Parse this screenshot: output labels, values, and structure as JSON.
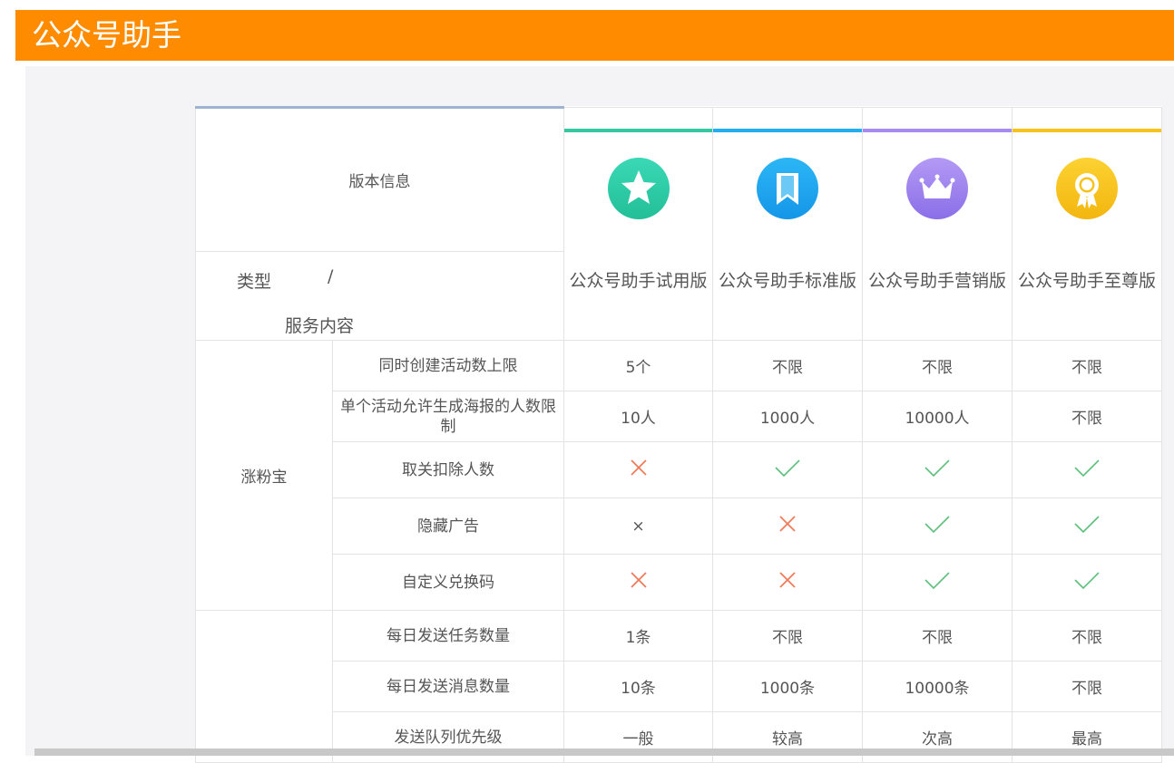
{
  "app": {
    "title": "公众号助手"
  },
  "header": {
    "info_label": "版本信息",
    "type_label": "类型",
    "slash": "/",
    "service_label": "服务内容"
  },
  "versions": [
    {
      "name": "公众号助手试用版",
      "accent": "#36c8a0",
      "icon": "star-icon"
    },
    {
      "name": "公众号助手标准版",
      "accent": "#22aef0",
      "icon": "bookmark-icon"
    },
    {
      "name": "公众号助手营销版",
      "accent": "#a48cf0",
      "icon": "crown-icon"
    },
    {
      "name": "公众号助手至尊版",
      "accent": "#f7c21b",
      "icon": "medal-icon"
    }
  ],
  "groups": [
    {
      "name": "涨粉宝",
      "rows": [
        {
          "feature": "同时创建活动数上限",
          "values": [
            "5个",
            "不限",
            "不限",
            "不限"
          ]
        },
        {
          "feature": "单个活动允许生成海报的人数限制",
          "values": [
            "10人",
            "1000人",
            "10000人",
            "不限"
          ]
        },
        {
          "feature": "取关扣除人数",
          "values": [
            "x",
            "v",
            "v",
            "v"
          ]
        },
        {
          "feature": "隐藏广告",
          "values": [
            "×",
            "x",
            "v",
            "v"
          ]
        },
        {
          "feature": "自定义兑换码",
          "values": [
            "x",
            "x",
            "v",
            "v"
          ]
        }
      ]
    },
    {
      "name": "",
      "rows": [
        {
          "feature": "每日发送任务数量",
          "values": [
            "1条",
            "不限",
            "不限",
            "不限"
          ]
        },
        {
          "feature": "每日发送消息数量",
          "values": [
            "10条",
            "1000条",
            "10000条",
            "不限"
          ]
        },
        {
          "feature": "发送队列优先级",
          "values": [
            "一般",
            "较高",
            "次高",
            "最高"
          ]
        }
      ]
    }
  ],
  "colors": {
    "brand": "#ff8c00",
    "cross": "#f07b5a",
    "check": "#5cc07a"
  }
}
